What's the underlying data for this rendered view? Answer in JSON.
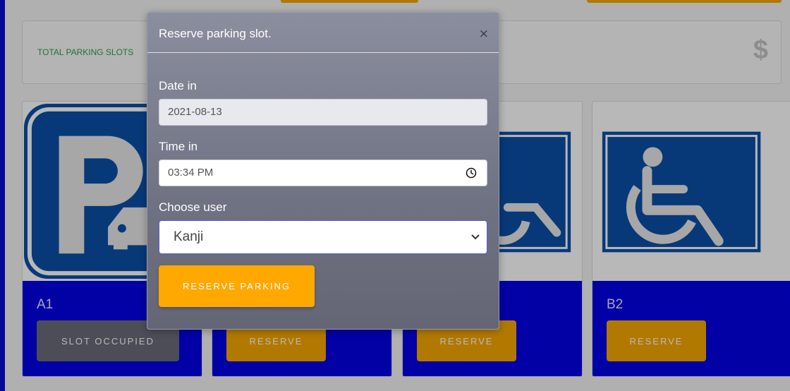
{
  "stats": {
    "label": "TOTAL PARKING SLOTS",
    "icon": "dollar-icon",
    "icon_glyph": "$"
  },
  "slots": [
    {
      "name": "A1",
      "button": "SLOT OCCUPIED",
      "status": "occupied",
      "image": "parking-sign"
    },
    {
      "name": "",
      "button": "RESERVE",
      "status": "available",
      "image": "parking-sign"
    },
    {
      "name": "",
      "button": "RESERVE",
      "status": "available",
      "image": "wheelchair-sign"
    },
    {
      "name": "B2",
      "button": "RESERVE",
      "status": "available",
      "image": "wheelchair-sign"
    }
  ],
  "modal": {
    "title": "Reserve parking slot.",
    "close": "×",
    "date_label": "Date in",
    "date_value": "2021-08-13",
    "time_label": "Time in",
    "time_value": "03:34 PM",
    "user_label": "Choose user",
    "user_value": "Kanji",
    "submit": "RESERVE PARKING"
  },
  "colors": {
    "accent": "#ffa800",
    "slot_footer": "#0202e6",
    "occupied": "#6b6b7b",
    "sign_blue": "#0a4fa8"
  }
}
